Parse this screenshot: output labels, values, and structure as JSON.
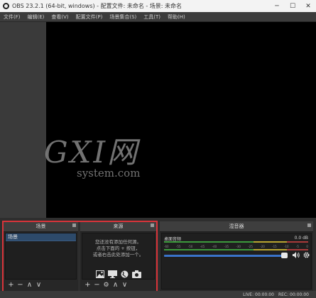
{
  "window": {
    "title": "OBS 23.2.1 (64-bit, windows) - 配置文件: 未命名 - 场景: 未命名",
    "min_glyph": "─",
    "max_glyph": "☐",
    "close_glyph": "✕"
  },
  "menu": {
    "items": [
      "文件(F)",
      "编辑(E)",
      "查看(V)",
      "配置文件(P)",
      "场景集合(S)",
      "工具(T)",
      "帮助(H)"
    ]
  },
  "watermark": {
    "logo": "GXI网",
    "sub": "system.com"
  },
  "scenes": {
    "title": "场景",
    "items": [
      "场景"
    ],
    "toolbar": [
      "+",
      "−",
      "∧",
      "∨"
    ]
  },
  "sources": {
    "title": "来源",
    "empty_text_lines": [
      "您还没有添加任何源。",
      "点击下面的 + 按钮，",
      "或者右击此处添加一个。"
    ],
    "toolbar": [
      "+",
      "−",
      "⚙",
      "∧",
      "∨"
    ]
  },
  "mixer": {
    "title": "混音器",
    "track_label": "桌面音频",
    "db_value": "0.0 dB",
    "scale_labels": [
      "-60",
      "-55",
      "-50",
      "-45",
      "-40",
      "-35",
      "-30",
      "-25",
      "-20",
      "-15",
      "-10",
      "-5",
      "0"
    ],
    "volume_level": 1.0
  },
  "status": {
    "live": "LIVE: 00:00:00",
    "rec": "REC: 00:00:00"
  },
  "colors": {
    "highlight": "#d9343a",
    "accent": "#3a73c9",
    "meter_green": "#3c9a3c",
    "meter_yellow": "#b8a430",
    "meter_red": "#a83a3a"
  }
}
